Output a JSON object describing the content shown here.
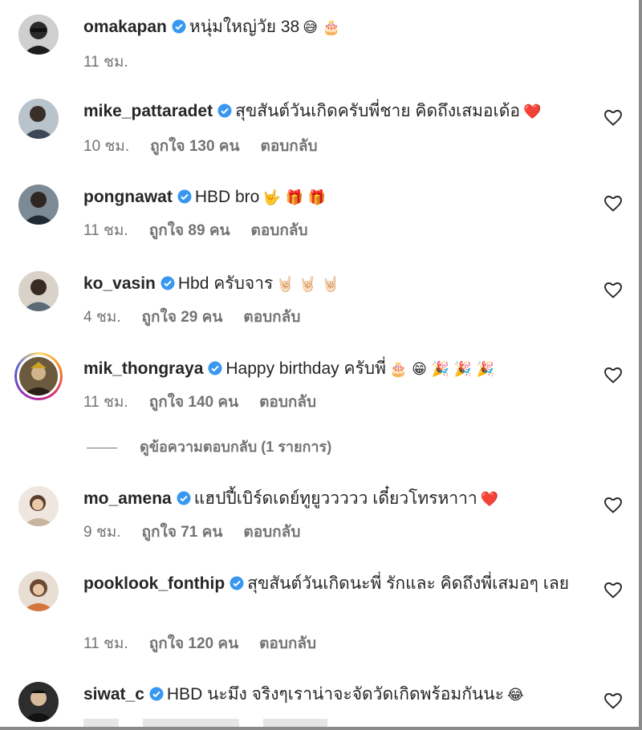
{
  "comments": [
    {
      "username": "omakapan",
      "text": "หนุ่มใหญ่วัย 38",
      "emojis": "😅 🎂",
      "time": "11 ชม.",
      "likes": "",
      "reply": "",
      "has_heart": false
    },
    {
      "username": "mike_pattaradet",
      "text": "สุขสันต์วันเกิดครับพี่ชาย คิดถึงเสมอเด้อ",
      "emojis": "❤️",
      "time": "10 ชม.",
      "likes": "ถูกใจ 130 คน",
      "reply": "ตอบกลับ",
      "has_heart": true
    },
    {
      "username": "pongnawat",
      "text": "HBD bro",
      "emojis": "🤟 🎁 🎁",
      "time": "11 ชม.",
      "likes": "ถูกใจ 89 คน",
      "reply": "ตอบกลับ",
      "has_heart": true
    },
    {
      "username": "ko_vasin",
      "text": "Hbd ครับจาร",
      "emojis": "🤘🏻 🤘🏻 🤘🏻",
      "time": "4 ชม.",
      "likes": "ถูกใจ 29 คน",
      "reply": "ตอบกลับ",
      "has_heart": true
    },
    {
      "username": "mik_thongraya",
      "text": "Happy birthday ครับพี่",
      "emojis": "🎂 😁 🎉 🎉 🎉",
      "time": "11 ชม.",
      "likes": "ถูกใจ 140 คน",
      "reply": "ตอบกลับ",
      "has_heart": true
    },
    {
      "username": "mo_amena",
      "text": "แฮปปี้เบิร์ดเดย์ทูยูววววว เดี๋ยวโทรหาาา",
      "emojis": "❤️",
      "time": "9 ชม.",
      "likes": "ถูกใจ 71 คน",
      "reply": "ตอบกลับ",
      "has_heart": true
    },
    {
      "username": "pooklook_fonthip",
      "text": "สุขสันต์วันเกิดนะพี่ รักและ คิดถึงพี่เสมอๆ เลย",
      "emojis": "",
      "time": "11 ชม.",
      "likes": "ถูกใจ 120 คน",
      "reply": "ตอบกลับ",
      "has_heart": true
    },
    {
      "username": "siwat_c",
      "text": "HBD นะมึง จริงๆเราน่าจะจัดวัดเกิดพร้อมกันนะ",
      "emojis": "😂",
      "time": "",
      "likes": "",
      "reply": "",
      "has_heart": true
    }
  ],
  "view_replies": "ดูข้อความตอบกลับ (1 รายการ)",
  "colors": {
    "verified": "#3897f0",
    "muted": "#737373",
    "text": "#262626"
  }
}
